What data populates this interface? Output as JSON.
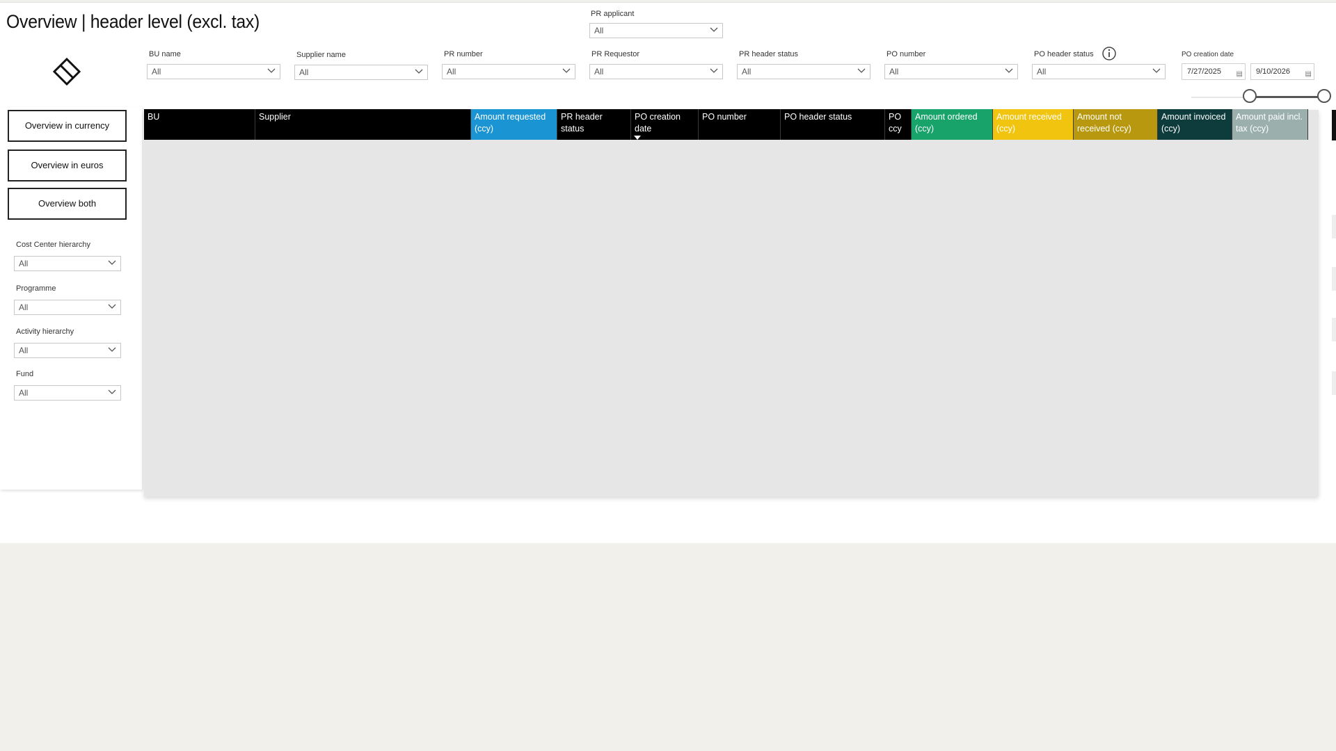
{
  "page": {
    "title": "Overview | header level (excl. tax)"
  },
  "filters": {
    "pr_applicant": {
      "label": "PR applicant",
      "value": "All"
    },
    "bu_name": {
      "label": "BU name",
      "value": "All"
    },
    "supplier_name": {
      "label": "Supplier name",
      "value": "All"
    },
    "pr_number": {
      "label": "PR number",
      "value": "All"
    },
    "pr_requestor": {
      "label": "PR Requestor",
      "value": "All"
    },
    "pr_header_status": {
      "label": "PR header status",
      "value": "All"
    },
    "po_number": {
      "label": "PO number",
      "value": "All"
    },
    "po_header_status": {
      "label": "PO header status",
      "value": "All"
    },
    "po_creation_date": {
      "label": "PO creation date",
      "start": "7/27/2025",
      "end": "9/10/2026",
      "slider_start_fraction": 0.44,
      "slider_end_fraction": 1.0
    }
  },
  "nav": {
    "currency": "Overview in currency",
    "euros": "Overview in euros",
    "both": "Overview both"
  },
  "side_filters": {
    "cost_center": {
      "label": "Cost Center hierarchy",
      "value": "All"
    },
    "programme": {
      "label": "Programme",
      "value": "All"
    },
    "activity": {
      "label": "Activity hierarchy",
      "value": "All"
    },
    "fund": {
      "label": "Fund",
      "value": "All"
    }
  },
  "table": {
    "columns": [
      {
        "label": "BU",
        "color": "#000000"
      },
      {
        "label": "Supplier",
        "color": "#000000"
      },
      {
        "label": "Amount requested (ccy)",
        "color": "#1a94d2"
      },
      {
        "label": "PR header status",
        "color": "#000000"
      },
      {
        "label": "PO creation date",
        "color": "#000000",
        "sorted": "descending"
      },
      {
        "label": "PO number",
        "color": "#000000"
      },
      {
        "label": "PO header status",
        "color": "#000000"
      },
      {
        "label": "PO ccy",
        "color": "#000000"
      },
      {
        "label": "Amount ordered (ccy)",
        "color": "#17a36a"
      },
      {
        "label": "Amount received (ccy)",
        "color": "#f1c40f"
      },
      {
        "label": "Amount not received (ccy)",
        "color": "#b8980f"
      },
      {
        "label": "Amount invoiced (ccy)",
        "color": "#0e3b3b"
      },
      {
        "label": "Amount paid incl. tax (ccy)",
        "color": "#9bb0ad"
      }
    ]
  },
  "icons": {
    "logo": "diamond-logo-icon",
    "info": "info-icon",
    "chevron": "chevron-down-icon",
    "calendar": "calendar-icon"
  }
}
